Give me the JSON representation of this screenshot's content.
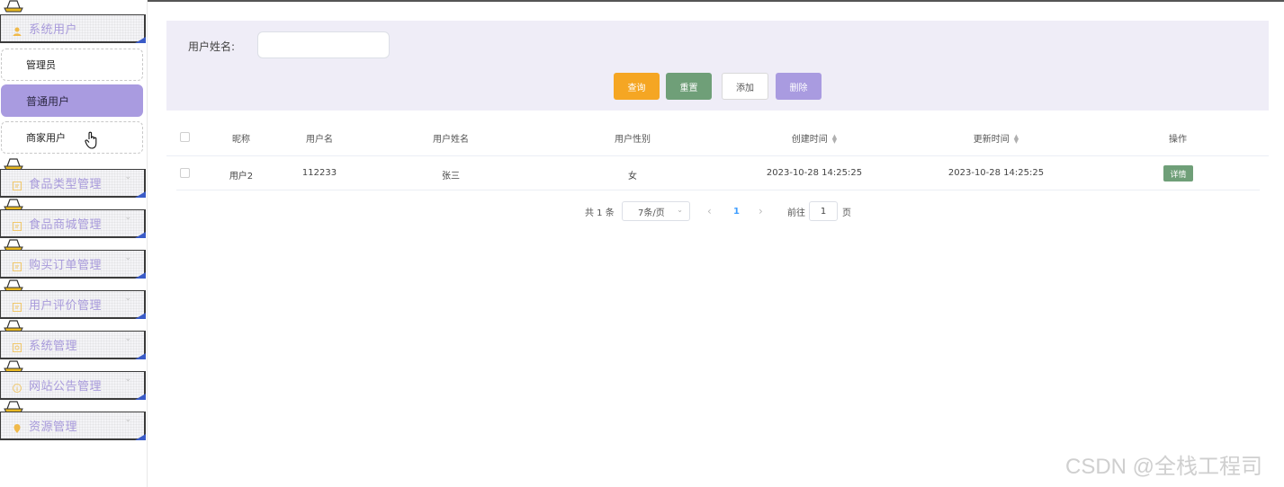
{
  "sidebar": {
    "groups": [
      {
        "label": "系统用户",
        "icon": "user-icon"
      },
      {
        "label": "食品类型管理",
        "icon": "document-icon"
      },
      {
        "label": "食品商城管理",
        "icon": "document-icon"
      },
      {
        "label": "购买订单管理",
        "icon": "document-icon"
      },
      {
        "label": "用户评价管理",
        "icon": "document-icon"
      },
      {
        "label": "系统管理",
        "icon": "settings-icon"
      },
      {
        "label": "网站公告管理",
        "icon": "info-icon"
      },
      {
        "label": "资源管理",
        "icon": "location-icon"
      }
    ],
    "sub_items": [
      {
        "label": "管理员",
        "active": false
      },
      {
        "label": "普通用户",
        "active": true
      },
      {
        "label": "商家用户",
        "active": false
      }
    ],
    "chevron": "⌄"
  },
  "search": {
    "label": "用户姓名:",
    "value": "",
    "placeholder": ""
  },
  "buttons": {
    "query": "查询",
    "reset": "重置",
    "add": "添加",
    "delete": "删除"
  },
  "table": {
    "headers": [
      "昵称",
      "用户名",
      "用户姓名",
      "用户性别",
      "创建时间",
      "更新时间",
      "操作"
    ],
    "rows": [
      {
        "nickname": "用户2",
        "username": "112233",
        "real_name": "张三",
        "gender": "女",
        "created": "2023-10-28 14:25:25",
        "updated": "2023-10-28 14:25:25",
        "action": "详情"
      }
    ]
  },
  "pagination": {
    "total_text": "共 1 条",
    "page_size": "7条/页",
    "prev": "‹",
    "current_page": "1",
    "next": "›",
    "goto_label": "前往",
    "goto_value": "1",
    "page_suffix": "页"
  },
  "colors": {
    "accent": "#a99be0",
    "query": "#f5a623",
    "reset": "#6f9f78",
    "panel": "#efedf7",
    "link": "#409eff"
  },
  "watermark": "CSDN @全栈工程司"
}
